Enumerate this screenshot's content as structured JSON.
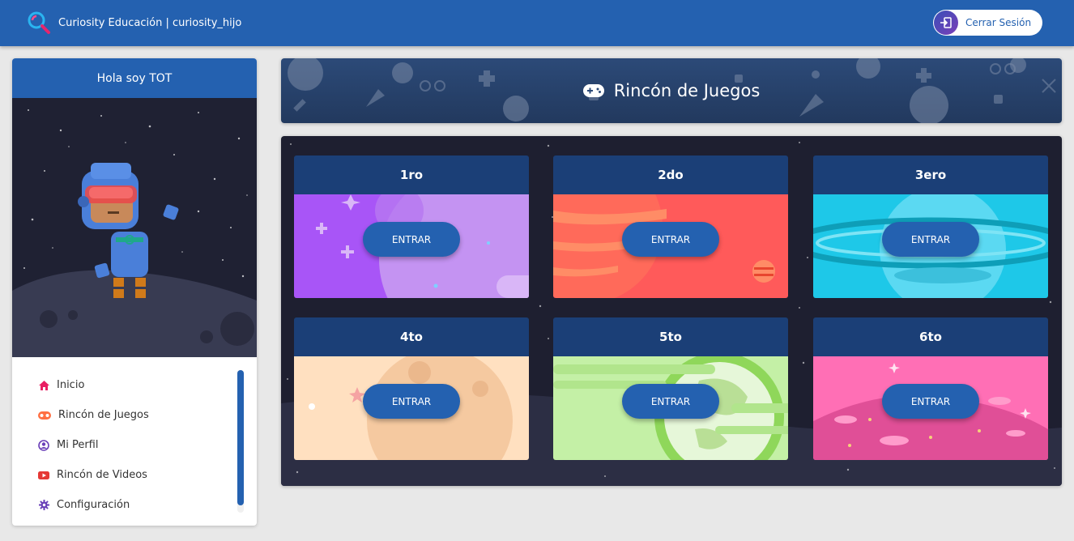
{
  "header": {
    "title": "Curiosity Educación | curiosity_hijo",
    "logout_label": "Cerrar Sesión",
    "logo_icon": "magnifier-logo-icon",
    "logout_icon": "sign-out-icon"
  },
  "sidebar": {
    "greeting": "Hola soy TOT",
    "items": [
      {
        "label": "Inicio",
        "icon": "home-icon",
        "color": "#e91e63"
      },
      {
        "label": "Rincón de Juegos",
        "icon": "gamepad-icon",
        "color": "#ff7043"
      },
      {
        "label": "Mi Perfil",
        "icon": "user-circle-icon",
        "color": "#6a3fb8"
      },
      {
        "label": "Rincón de Videos",
        "icon": "youtube-icon",
        "color": "#e53935"
      },
      {
        "label": "Configuración",
        "icon": "gear-icon",
        "color": "#6a3fb8"
      }
    ]
  },
  "banner": {
    "title": "Rincón de Juegos",
    "icon": "gamepad-icon"
  },
  "grades": [
    {
      "label": "1ro",
      "button": "ENTRAR",
      "color": "#a855f7"
    },
    {
      "label": "2do",
      "button": "ENTRAR",
      "color": "#ff5a5a"
    },
    {
      "label": "3ero",
      "button": "ENTRAR",
      "color": "#1ec8e8"
    },
    {
      "label": "4to",
      "button": "ENTRAR",
      "color": "#ffe0c0"
    },
    {
      "label": "5to",
      "button": "ENTRAR",
      "color": "#c4f0a6"
    },
    {
      "label": "6to",
      "button": "ENTRAR",
      "color": "#ff6fb5"
    }
  ],
  "colors": {
    "primary": "#2461b0",
    "card_header": "#1b3f77",
    "panel_bg": "#1e1f30"
  }
}
